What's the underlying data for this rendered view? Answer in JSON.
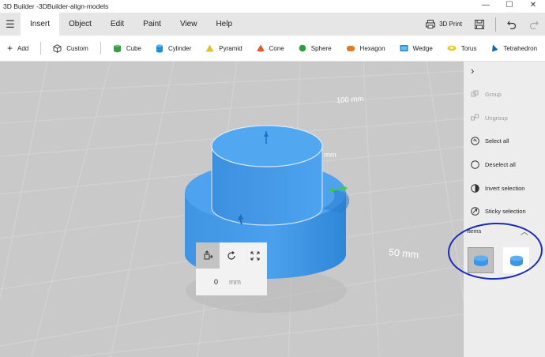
{
  "window": {
    "title": "3D Builder -3DBuilder-align-models",
    "minimize": "—",
    "maximize": "☐",
    "close": "✕"
  },
  "ribbon": {
    "menu_icon": "hamburger-icon",
    "tabs": [
      "Insert",
      "Object",
      "Edit",
      "Paint",
      "View",
      "Help"
    ],
    "active_tab": "Insert",
    "print_label": "3D Print"
  },
  "toolbar": {
    "add_label": "Add",
    "custom_label": "Custom",
    "shapes": [
      {
        "label": "Cube",
        "color": "#3a9a45"
      },
      {
        "label": "Cylinder",
        "color": "#1f8fd6"
      },
      {
        "label": "Pyramid",
        "color": "#e1c22a"
      },
      {
        "label": "Cone",
        "color": "#e05a2a"
      },
      {
        "label": "Sphere",
        "color": "#2f9e3f"
      },
      {
        "label": "Hexagon",
        "color": "#e07b2a"
      },
      {
        "label": "Wedge",
        "color": "#1b8ad0"
      },
      {
        "label": "Torus",
        "color": "#e8c824"
      },
      {
        "label": "Tetrahedron",
        "color": "#1565b0"
      }
    ]
  },
  "viewport": {
    "dimension_100": "100 mm",
    "dimension_mm": "mm",
    "dimension_50": "50 mm",
    "background": "#c9c9c9",
    "model_color": "#3d95e6"
  },
  "transform_panel": {
    "value": "0",
    "unit": "mm"
  },
  "side_panel": {
    "actions": [
      {
        "label": "Group",
        "enabled": false
      },
      {
        "label": "Ungroup",
        "enabled": false
      },
      {
        "label": "Select all",
        "enabled": true
      },
      {
        "label": "Deselect all",
        "enabled": true
      },
      {
        "label": "Invert selection",
        "enabled": true
      },
      {
        "label": "Sticky selection",
        "enabled": true
      }
    ],
    "items_label": "Items"
  }
}
